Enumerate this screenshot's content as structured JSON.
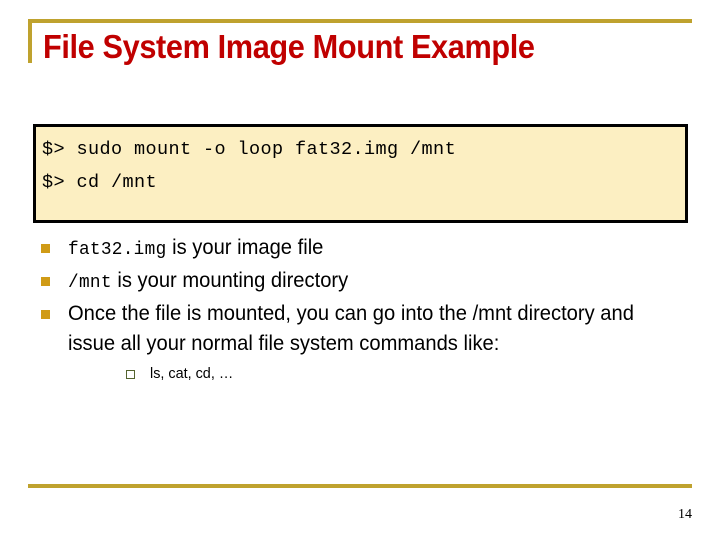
{
  "slide": {
    "title": "File System Image Mount Example",
    "page_number": "14",
    "accent_gold": "#BFA22E",
    "title_red": "#C00000",
    "code_bg": "#FCEFC2",
    "bullet_gold": "#D09B16",
    "subbullet_outline": "#54632E"
  },
  "code_block": {
    "lines": [
      "$> sudo mount -o loop fat32.img /mnt",
      "$> cd /mnt"
    ]
  },
  "bullets": [
    {
      "mono": "fat32.img",
      "text": " is your image file"
    },
    {
      "mono": "/mnt",
      "text": "  is your mounting directory"
    },
    {
      "mono": "",
      "text": "Once the file is mounted, you can go into the /mnt directory and issue all your normal file system commands like:"
    }
  ],
  "sub_bullets": [
    {
      "text": "ls, cat, cd, …"
    }
  ]
}
